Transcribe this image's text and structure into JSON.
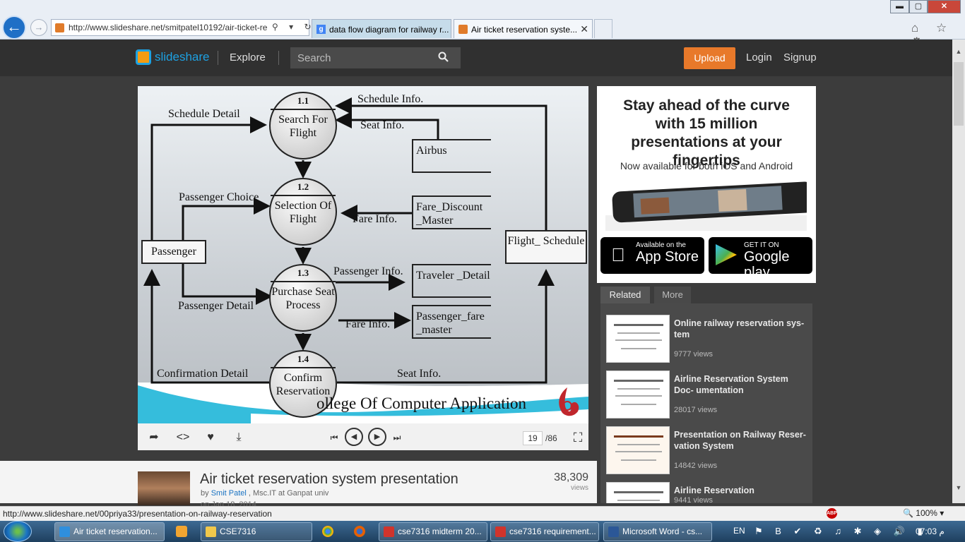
{
  "browser": {
    "address": "http://www.slideshare.net/smitpatel10192/air-ticket-re",
    "address_icons": "⚲ ▾ ↻",
    "tabs": [
      {
        "label": "data flow diagram for railway r..."
      },
      {
        "label": "Air ticket reservation syste...",
        "close": "✕"
      }
    ],
    "window_buttons": {
      "minimize": "▬",
      "maximize": "▢",
      "close": "✕"
    },
    "toolbar_icons": "⌂ ☆ ⚙"
  },
  "header": {
    "logo": "slideshare",
    "explore": "Explore",
    "search_placeholder": "Search",
    "upload": "Upload",
    "login": "Login",
    "signup": "Signup"
  },
  "slide": {
    "processes": [
      {
        "id": "1.1",
        "name": "Search For Flight"
      },
      {
        "id": "1.2",
        "name": "Selection Of Flight"
      },
      {
        "id": "1.3",
        "name": "Purchase Seat Process"
      },
      {
        "id": "1.4",
        "name": "Confirm Reservation"
      }
    ],
    "entities": {
      "passenger": "Passenger",
      "flight_schedule": "Flight_ Schedule"
    },
    "stores": {
      "airbus": "Airbus",
      "fare_discount": "Fare_Discount _Master",
      "traveler": "Traveler _Detail",
      "passenger_fare": "Passenger_fare _master"
    },
    "flows": {
      "schedule_info": "Schedule Info.",
      "schedule_detail": "Schedule Detail",
      "seat_info_top": "Seat Info.",
      "passenger_choice": "Passenger Choice",
      "fare_info_1": "Fare Info.",
      "passenger_info": "Passenger Info.",
      "passenger_detail": "Passenger Detail",
      "fare_info_2": "Fare Info.",
      "confirmation_detail": "Confirmation Detail",
      "seat_info_bottom": "Seat Info."
    },
    "footer_text": "ollege Of Computer Application"
  },
  "player": {
    "share": "➦",
    "embed": "<>",
    "like": "♥",
    "download": "⤓",
    "first": "⏮",
    "prev": "◀",
    "next": "▶",
    "last": "⏭",
    "current_page": "19",
    "total_pages": "/86",
    "fullscreen": "⛶"
  },
  "ad": {
    "headline": "Stay ahead of the curve with 15 million presentations at your fingertips",
    "subline": "Now available for both iOS and Android",
    "appstore_small": "Available on the",
    "appstore_big": "App Store",
    "gplay_small": "GET IT ON",
    "gplay_big": "Google play"
  },
  "related": {
    "tab_related": "Related",
    "tab_more": "More",
    "items": [
      {
        "title": "Online railway reservation sys- tem",
        "views": "9777 views"
      },
      {
        "title": "Airline Reservation System Doc- umentation",
        "views": "28017 views"
      },
      {
        "title": "Presentation on Railway Reser- vation System",
        "views": "14842 views"
      },
      {
        "title": "Airline Reservation",
        "views": "9441 views"
      }
    ]
  },
  "presentation": {
    "title": "Air ticket reservation system presentation",
    "by": "by",
    "author": "Smit Patel",
    "affiliation": ", Msc.IT at Ganpat univ",
    "date": "on Jan 18, 2014",
    "views": "38,309",
    "views_label": "views"
  },
  "status": {
    "url": "http://www.slideshare.net/00priya33/presentation-on-railway-reservation",
    "abp": "ABP",
    "zoom": "🔍 100%  ▾"
  },
  "taskbar": {
    "items": [
      {
        "label": "Air ticket reservation..."
      },
      {
        "label": "CSE7316"
      },
      {
        "label": "cse7316 midterm 20..."
      },
      {
        "label": "cse7316 requirement..."
      },
      {
        "label": "Microsoft Word - cs..."
      }
    ],
    "lang": "EN",
    "tray": "⚑ B ✔ ♻ ♫ ✱ ◈ 🔊 ▮",
    "clock": "07:03 م"
  }
}
